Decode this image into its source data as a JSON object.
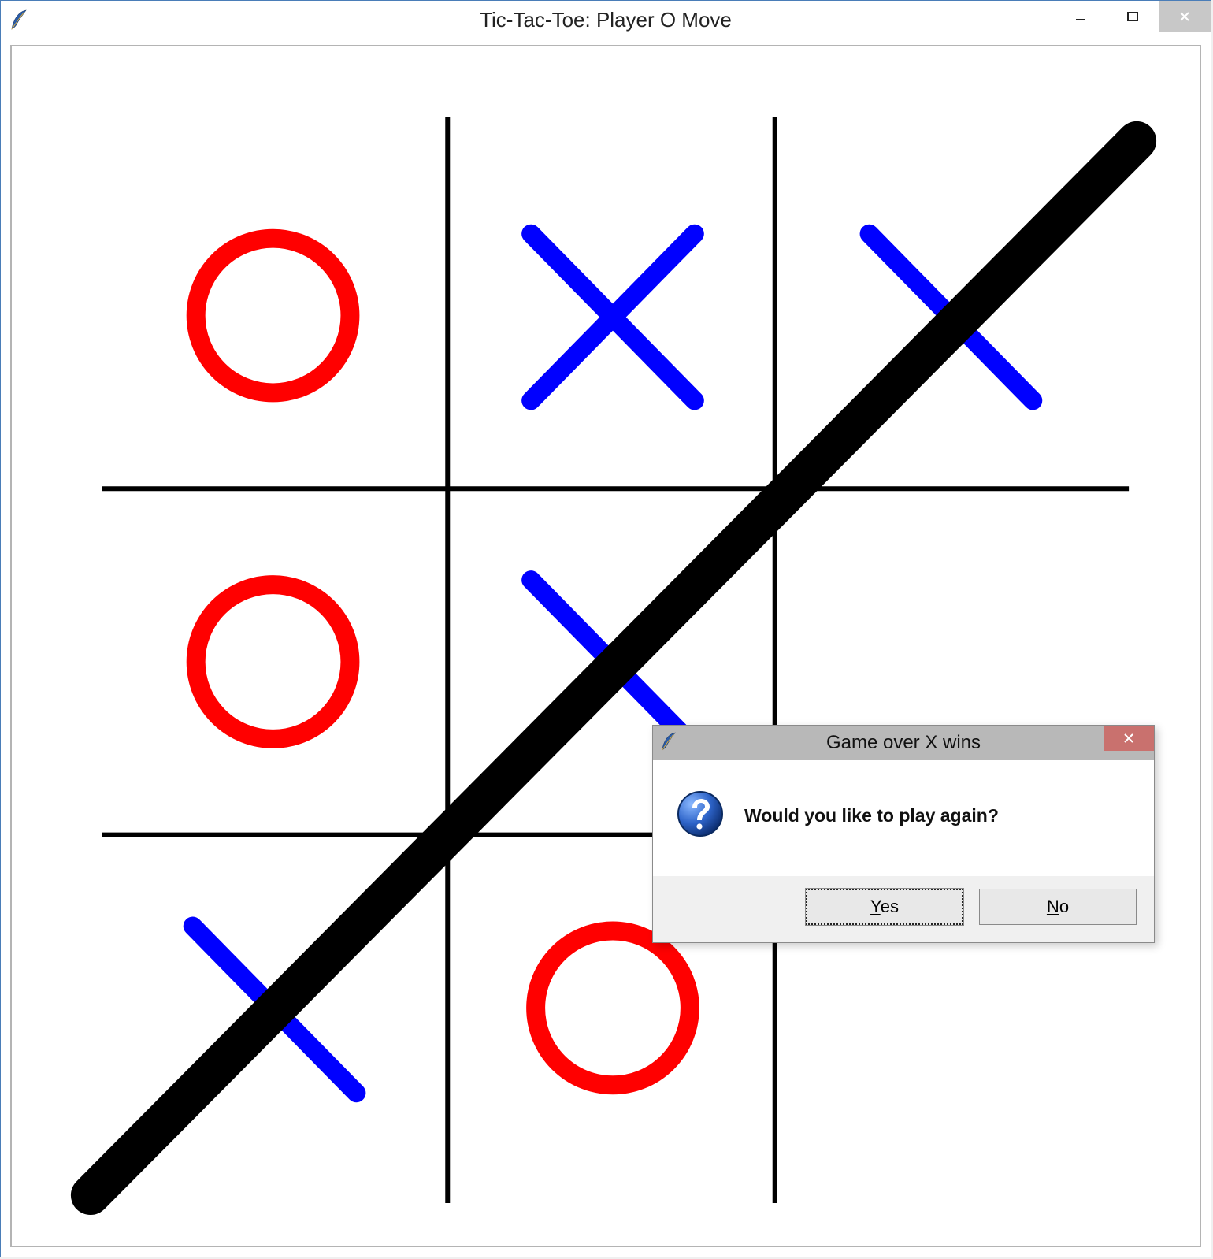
{
  "window": {
    "title": "Tic-Tac-Toe: Player O Move"
  },
  "game": {
    "board": [
      [
        "O",
        "X",
        "X"
      ],
      [
        "O",
        "X",
        ""
      ],
      [
        "X",
        "O",
        ""
      ]
    ],
    "current_player": "O",
    "winner": "X",
    "win_line": "anti-diagonal",
    "colors": {
      "X": "#0000ff",
      "O": "#ff0000",
      "grid": "#000000",
      "strike": "#000000"
    }
  },
  "dialog": {
    "title": "Game over  X wins",
    "message": "Would you like to play again?",
    "yes_label": "Yes",
    "no_label": "No"
  }
}
